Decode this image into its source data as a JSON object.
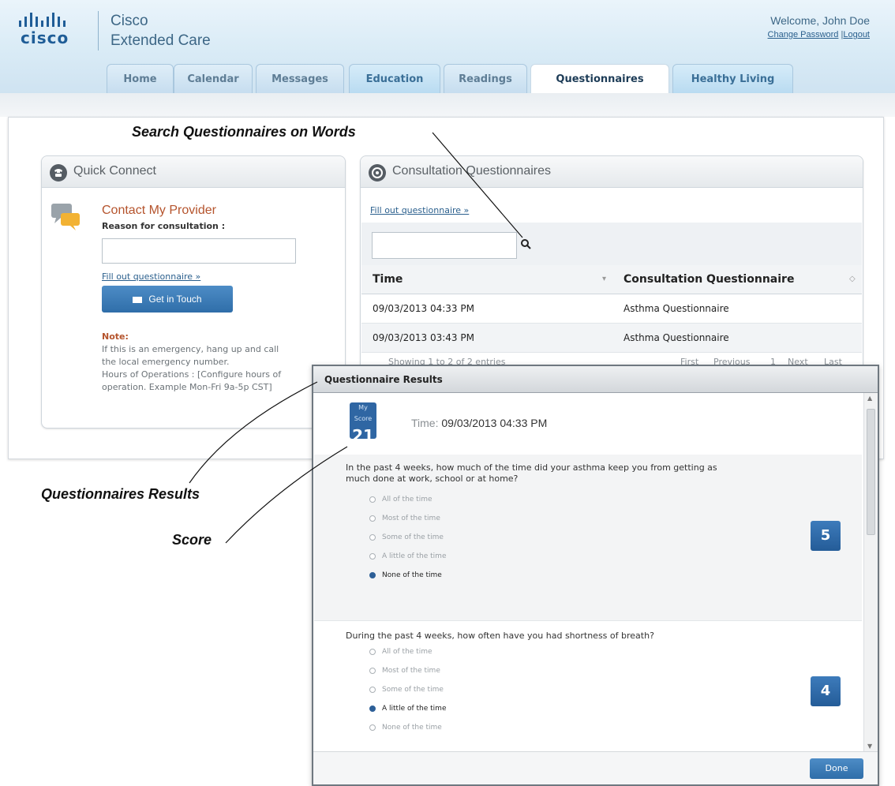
{
  "header": {
    "logo_text": "cisco",
    "app_title_line1": "Cisco",
    "app_title_line2": "Extended Care",
    "welcome": "Welcome, John Doe",
    "change_password": "Change Password",
    "separator": " |",
    "logout": "Logout"
  },
  "tabs": [
    "Home",
    "Calendar",
    "Messages",
    "Education",
    "Readings",
    "Questionnaires",
    "Healthy Living"
  ],
  "active_tab": "Questionnaires",
  "callouts": {
    "search": "Search Questionnaires on Words",
    "results": "Questionnaires Results",
    "score": "Score"
  },
  "quick_connect": {
    "title": "Quick Connect",
    "contact": "Contact My Provider",
    "reason_label": "Reason for consultation :",
    "reason_value": "",
    "fill_link": "Fill out questionnaire »",
    "button": "Get in Touch",
    "note_title": "Note:",
    "note_lines": [
      "If this is an emergency, hang up and call",
      "the local emergency number.",
      "Hours of Operations : [Configure hours of",
      "operation. Example Mon-Fri 9a-5p CST]"
    ]
  },
  "consultation": {
    "title": "Consultation Questionnaires",
    "fill_link": "Fill out questionnaire »",
    "search_value": "",
    "columns": [
      "Time",
      "Consultation Questionnaire"
    ],
    "rows": [
      [
        "09/03/2013 04:33 PM",
        "Asthma Questionnaire"
      ],
      [
        "09/03/2013 03:43 PM",
        "Asthma Questionnaire"
      ]
    ],
    "showing": "Showing 1 to 2 of 2 entries",
    "pager": [
      "First",
      "Previous",
      "1",
      "Next",
      "Last"
    ]
  },
  "results": {
    "title": "Questionnaire Results",
    "score_label": "My Score",
    "score": "21",
    "time_label": "Time:",
    "time_value": "09/03/2013 04:33 PM",
    "questions": [
      {
        "text_line1": "In the past 4 weeks, how much of the time did your asthma keep you from getting as",
        "text_line2": "much done at work, school or at home?",
        "options": [
          "All of the time",
          "Most of the time",
          "Some of the time",
          "A little of the time",
          "None of the time"
        ],
        "selected": 4,
        "score": "5"
      },
      {
        "text_line1": "During the past 4 weeks, how often have you had shortness of breath?",
        "text_line2": "",
        "options": [
          "All of the time",
          "Most of the time",
          "Some of the time",
          "A little of the time",
          "None of the time"
        ],
        "selected": 3,
        "score": "4"
      }
    ],
    "done": "Done"
  },
  "colors": {
    "brand_blue": "#2f6ea9",
    "accent_orange": "#b5542d",
    "header_bg": "#d9ebf6"
  }
}
